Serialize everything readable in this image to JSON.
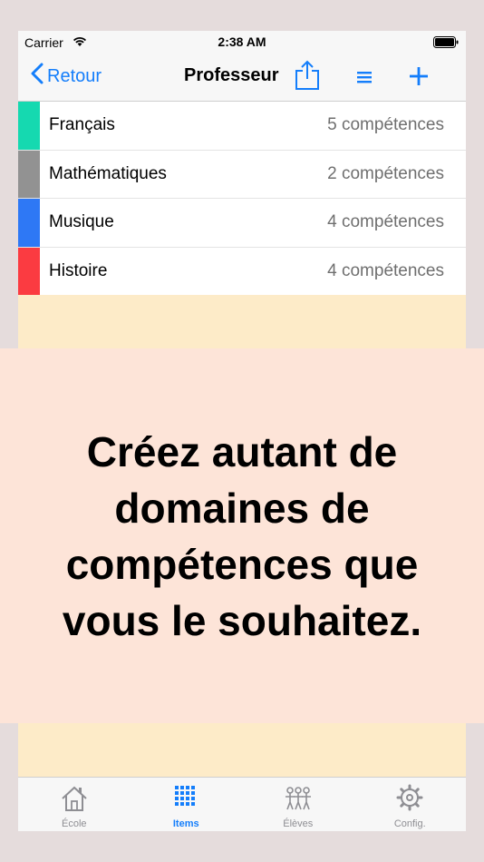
{
  "status_bar": {
    "carrier": "Carrier",
    "time": "2:38 AM"
  },
  "nav": {
    "back_label": "Retour",
    "title": "Professeur"
  },
  "domains": [
    {
      "name": "Français",
      "count": "5 compétences",
      "color": "#15d9b0"
    },
    {
      "name": "Mathématiques",
      "count": "2 compétences",
      "color": "#929292"
    },
    {
      "name": "Musique",
      "count": "4 compétences",
      "color": "#2e78f5"
    },
    {
      "name": "Histoire",
      "count": "4 compétences",
      "color": "#fb3b41"
    }
  ],
  "banner": {
    "text": "Créez autant de domaines de compétences que vous le souhaitez."
  },
  "tabs": [
    {
      "label": "École",
      "icon": "house-icon",
      "active": false
    },
    {
      "label": "Items",
      "icon": "grid-icon",
      "active": true
    },
    {
      "label": "Élèves",
      "icon": "students-icon",
      "active": false
    },
    {
      "label": "Config.",
      "icon": "gear-icon",
      "active": false
    }
  ],
  "colors": {
    "accent": "#147efb",
    "background": "#fdebc8",
    "banner": "#fde4d8"
  }
}
